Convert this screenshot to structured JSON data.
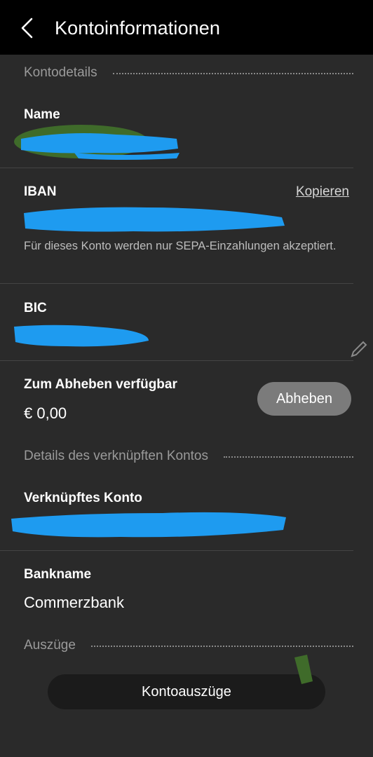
{
  "header": {
    "title": "Kontoinformationen",
    "back_icon": "chevron-left-icon"
  },
  "sections": {
    "account_details": "Kontodetails",
    "linked_account_details": "Details des verknüpften Kontos",
    "statements": "Auszüge"
  },
  "fields": {
    "name_label": "Name",
    "iban_label": "IBAN",
    "iban_copy": "Kopieren",
    "iban_note": "Für dieses Konto werden nur SEPA-Einzahlungen akzeptiert.",
    "bic_label": "BIC",
    "withdraw_label": "Zum Abheben verfügbar",
    "withdraw_value": "€ 0,00",
    "withdraw_button": "Abheben",
    "linked_account_label": "Verknüpftes Konto",
    "bank_name_label": "Bankname",
    "bank_name_value": "Commerzbank"
  },
  "statements": {
    "button": "Kontoauszüge"
  },
  "colors": {
    "background": "#2a2a2a",
    "header": "#000000",
    "redaction_blue": "#1e9bf0",
    "redaction_green": "#3f6b2a",
    "button_gray": "#7b7b7b"
  }
}
